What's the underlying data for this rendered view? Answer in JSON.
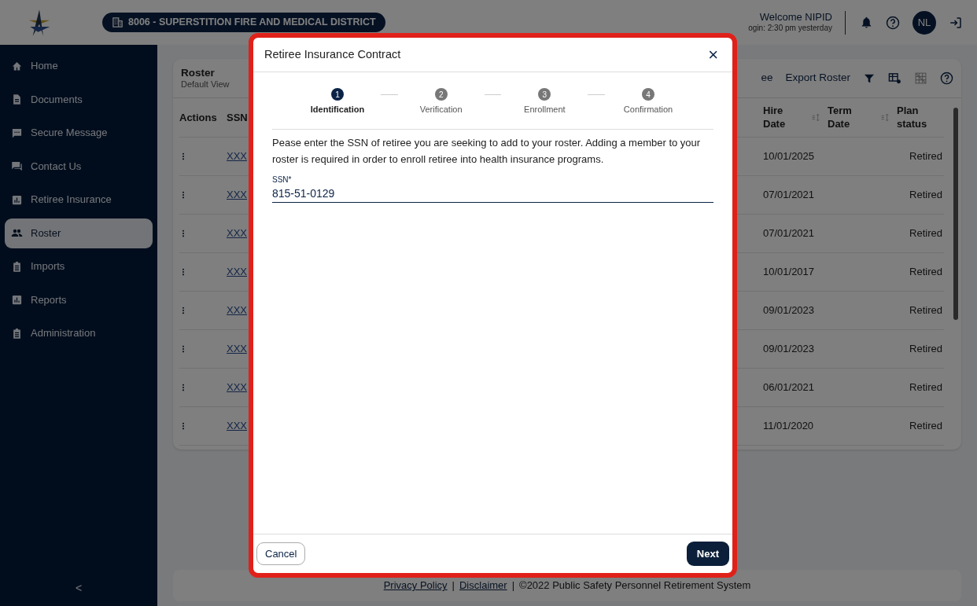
{
  "header": {
    "district": "8006 - SUPERSTITION FIRE AND MEDICAL DISTRICT",
    "welcome": "Welcome NIPID",
    "last_login": "ogin: 2:30 pm yesterday",
    "avatar": "NL"
  },
  "sidebar": {
    "items": [
      {
        "label": "Home",
        "selected": false
      },
      {
        "label": "Documents",
        "selected": false
      },
      {
        "label": "Secure Message",
        "selected": false
      },
      {
        "label": "Contact Us",
        "selected": false
      },
      {
        "label": "Retiree Insurance",
        "selected": false
      },
      {
        "label": "Roster",
        "selected": true
      },
      {
        "label": "Imports",
        "selected": false
      },
      {
        "label": "Reports",
        "selected": false
      },
      {
        "label": "Administration",
        "selected": false
      }
    ],
    "collapse": "<"
  },
  "roster": {
    "title": "Roster",
    "subtitle": "Default View",
    "toolbar_actions": [
      "ee",
      "Export Roster"
    ],
    "columns": [
      "Actions",
      "SSN",
      "Hire Date",
      "Term Date",
      "Plan status"
    ],
    "rows": [
      {
        "ssn": "XXX",
        "hire_date": "10/01/2025",
        "plan_status": "Retired"
      },
      {
        "ssn": "XXX",
        "hire_date": "07/01/2021",
        "plan_status": "Retired"
      },
      {
        "ssn": "XXX",
        "hire_date": "07/01/2021",
        "plan_status": "Retired"
      },
      {
        "ssn": "XXX",
        "hire_date": "10/01/2017",
        "plan_status": "Retired"
      },
      {
        "ssn": "XXX",
        "hire_date": "09/01/2023",
        "plan_status": "Retired"
      },
      {
        "ssn": "XXX",
        "hire_date": "09/01/2023",
        "plan_status": "Retired"
      },
      {
        "ssn": "XXX",
        "hire_date": "06/01/2021",
        "plan_status": "Retired"
      },
      {
        "ssn": "XXX",
        "hire_date": "11/01/2020",
        "plan_status": "Retired"
      }
    ]
  },
  "modal": {
    "title": "Retiree Insurance Contract",
    "close": "×",
    "steps": [
      {
        "number": "1",
        "label": "Identification",
        "selected": true
      },
      {
        "number": "2",
        "label": "Verification",
        "selected": false
      },
      {
        "number": "3",
        "label": "Enrollment",
        "selected": false
      },
      {
        "number": "4",
        "label": "Confirmation",
        "selected": false
      }
    ],
    "instructions": "Pease enter the SSN of retiree you are seeking to add to your roster. Adding a member to your roster is required in order to enroll retiree into health insurance programs.",
    "field": {
      "label": "SSN*",
      "value": "815-51-0129"
    },
    "buttons": {
      "cancel": "Cancel",
      "next": "Next"
    }
  },
  "footer": {
    "links": [
      "Privacy Policy",
      "Disclaimer"
    ],
    "separator": "|",
    "copyright": "©2022 Public Safety Personnel Retirement System"
  }
}
